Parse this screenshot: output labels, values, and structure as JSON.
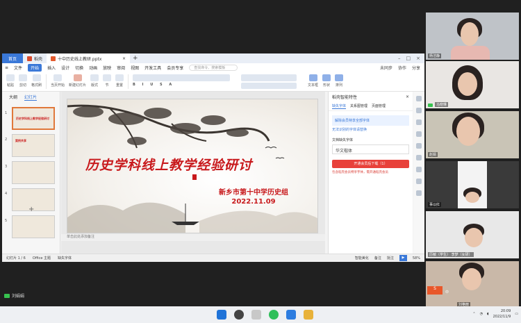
{
  "wps": {
    "tabs": {
      "home": "首页",
      "wps_tab": "稻壳",
      "file_tab": "十中历史线上教研.pptx"
    },
    "menu": {
      "file": "文件",
      "start": "开始",
      "insert": "插入",
      "design": "设计",
      "transition": "切换",
      "animation": "动画",
      "show": "放映",
      "review": "审阅",
      "view": "视图",
      "dev": "开发工具",
      "member": "会员专享",
      "search_placeholder": "查找命令、搜索模板",
      "sync": "未同步",
      "collab": "协作",
      "share": "分享"
    },
    "ribbon": {
      "paste": "粘贴",
      "cut": "剪切",
      "format_painter": "格式刷",
      "play_from": "当页开始",
      "new_slide": "新建幻灯片",
      "layout": "版式",
      "section": "节",
      "reset": "重置",
      "textbox": "文本框",
      "shape": "形状",
      "arrange": "排列"
    },
    "leftpane": {
      "outline_tab": "大纲",
      "slides_tab": "幻灯片",
      "thumb1_title": "历史学科线上教学经验研讨",
      "thumb2_title": "案例共享",
      "numbers": [
        "1",
        "2",
        "3",
        "4",
        "5"
      ]
    },
    "slide": {
      "title": "历史学科线上教学经验研讨",
      "group": "新乡市第十中学历史组",
      "date": "2022.11.09"
    },
    "notes": "单击此处添加备注",
    "rightpane": {
      "header": "稻壳智能特性",
      "tab_missing_font": "缺失字体",
      "tab_relation": "关系图管理",
      "tab_beautify": "页面管理",
      "notice": "解除会员特享全部字体",
      "link": "无法识别的字体请替换",
      "font_label": "文档缺失字体",
      "font_name": "华文楷体",
      "download_btn": "开通会员后下载（1）",
      "warn": "包含稻壳会员特享字体，需开通稻壳会员"
    },
    "status": {
      "slide_count": "幻灯片 1 / 6",
      "theme": "Office 主题",
      "missing_font": "缺失字体",
      "smart": "智能美化",
      "notes": "备注",
      "comment": "批注",
      "zoom": "58%"
    }
  },
  "participants": [
    {
      "name": "杨洁静"
    },
    {
      "name": "马晓琳"
    },
    {
      "name": "赵娟"
    },
    {
      "name": "事以红"
    },
    {
      "name": "历敏（学生） 李梦（女研）"
    },
    {
      "name": "刘艳丽"
    }
  ],
  "bottom_badge": "刘娟娟",
  "taskbar": {
    "time": "20:09",
    "date": "2022/11/9",
    "lang": "中"
  }
}
